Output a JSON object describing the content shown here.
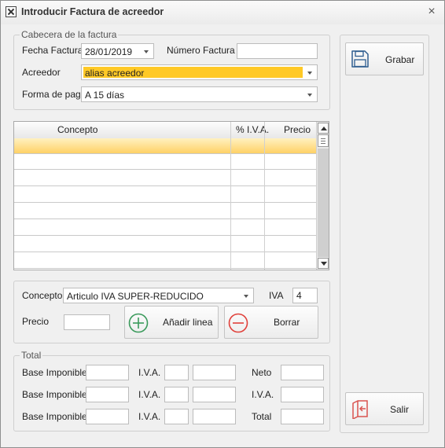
{
  "window": {
    "title": "Introducir Factura de acreedor",
    "close_glyph": "×"
  },
  "header": {
    "legend": "Cabecera de la factura",
    "fecha_label": "Fecha Factura",
    "fecha_value": "28/01/2019",
    "numero_label": "Número Factura",
    "numero_value": "",
    "acreedor_label": "Acreedor",
    "acreedor_value": "alias acreedor",
    "forma_pago_label": "Forma de pago",
    "forma_pago_value": "A 15 días"
  },
  "grid": {
    "columns": [
      "Concepto",
      "% I.V.A.",
      "Precio"
    ],
    "rows": [
      {
        "concepto": "",
        "iva": "",
        "precio": "",
        "selected": true
      },
      {
        "concepto": "",
        "iva": "",
        "precio": ""
      },
      {
        "concepto": "",
        "iva": "",
        "precio": ""
      },
      {
        "concepto": "",
        "iva": "",
        "precio": ""
      },
      {
        "concepto": "",
        "iva": "",
        "precio": ""
      },
      {
        "concepto": "",
        "iva": "",
        "precio": ""
      },
      {
        "concepto": "",
        "iva": "",
        "precio": ""
      },
      {
        "concepto": "",
        "iva": "",
        "precio": ""
      }
    ]
  },
  "line_entry": {
    "concepto_label": "Concepto",
    "concepto_value": "Articulo IVA SUPER-REDUCIDO",
    "iva_label": "IVA",
    "iva_value": "4",
    "precio_label": "Precio",
    "precio_value": "",
    "add_label": "Añadir linea",
    "delete_label": "Borrar"
  },
  "totals": {
    "legend": "Total",
    "base_label": "Base Imponible",
    "iva_label": "I.V.A.",
    "neto_label": "Neto",
    "iva_total_label": "I.V.A.",
    "total_label": "Total"
  },
  "actions": {
    "save_label": "Grabar",
    "exit_label": "Salir"
  },
  "colors": {
    "highlight": "#ffc926",
    "add_icon": "#3a9a5b",
    "delete_icon": "#e0403a",
    "exit_icon": "#d9534f",
    "save_icon": "#2e5d8f"
  }
}
